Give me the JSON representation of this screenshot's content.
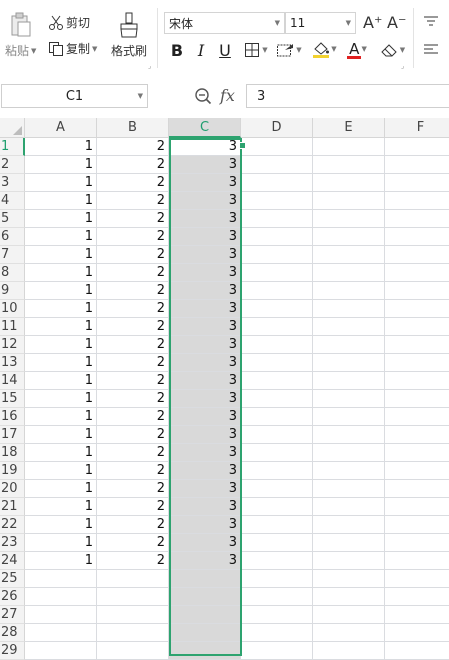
{
  "ribbon": {
    "paste_label": "粘贴",
    "cut_label": "剪切",
    "copy_label": "复制",
    "format_painter_label": "格式刷",
    "font_name": "宋体",
    "font_size": "11",
    "bold_label": "B",
    "italic_label": "I",
    "underline_label": "U",
    "font_color_letter": "A",
    "increase_font_icon": "A⁺",
    "decrease_font_icon": "A⁻"
  },
  "formula_bar": {
    "name_box": "C1",
    "fx_label": "fx",
    "value": "3"
  },
  "sheet": {
    "columns": [
      "A",
      "B",
      "C",
      "D",
      "E",
      "F"
    ],
    "row_numbers": [
      "1",
      "2",
      "3",
      "4",
      "5",
      "6",
      "7",
      "8",
      "9",
      "10",
      "11",
      "12",
      "13",
      "14",
      "15",
      "16",
      "17",
      "18",
      "19",
      "20",
      "21",
      "22",
      "23",
      "24",
      "25",
      "26",
      "27",
      "28",
      "29"
    ],
    "data_rows": [
      [
        "1",
        "2",
        "3"
      ],
      [
        "1",
        "2",
        "3"
      ],
      [
        "1",
        "2",
        "3"
      ],
      [
        "1",
        "2",
        "3"
      ],
      [
        "1",
        "2",
        "3"
      ],
      [
        "1",
        "2",
        "3"
      ],
      [
        "1",
        "2",
        "3"
      ],
      [
        "1",
        "2",
        "3"
      ],
      [
        "1",
        "2",
        "3"
      ],
      [
        "1",
        "2",
        "3"
      ],
      [
        "1",
        "2",
        "3"
      ],
      [
        "1",
        "2",
        "3"
      ],
      [
        "1",
        "2",
        "3"
      ],
      [
        "1",
        "2",
        "3"
      ],
      [
        "1",
        "2",
        "3"
      ],
      [
        "1",
        "2",
        "3"
      ],
      [
        "1",
        "2",
        "3"
      ],
      [
        "1",
        "2",
        "3"
      ],
      [
        "1",
        "2",
        "3"
      ],
      [
        "1",
        "2",
        "3"
      ],
      [
        "1",
        "2",
        "3"
      ],
      [
        "1",
        "2",
        "3"
      ],
      [
        "1",
        "2",
        "3"
      ],
      [
        "1",
        "2",
        "3"
      ]
    ],
    "selected_column": "C",
    "active_cell": "C1"
  },
  "colors": {
    "selection": "#2da36f",
    "highlight": "#d9d9d9",
    "font_color_bar": "#e02020",
    "fill_color_bar": "#f2d230"
  }
}
